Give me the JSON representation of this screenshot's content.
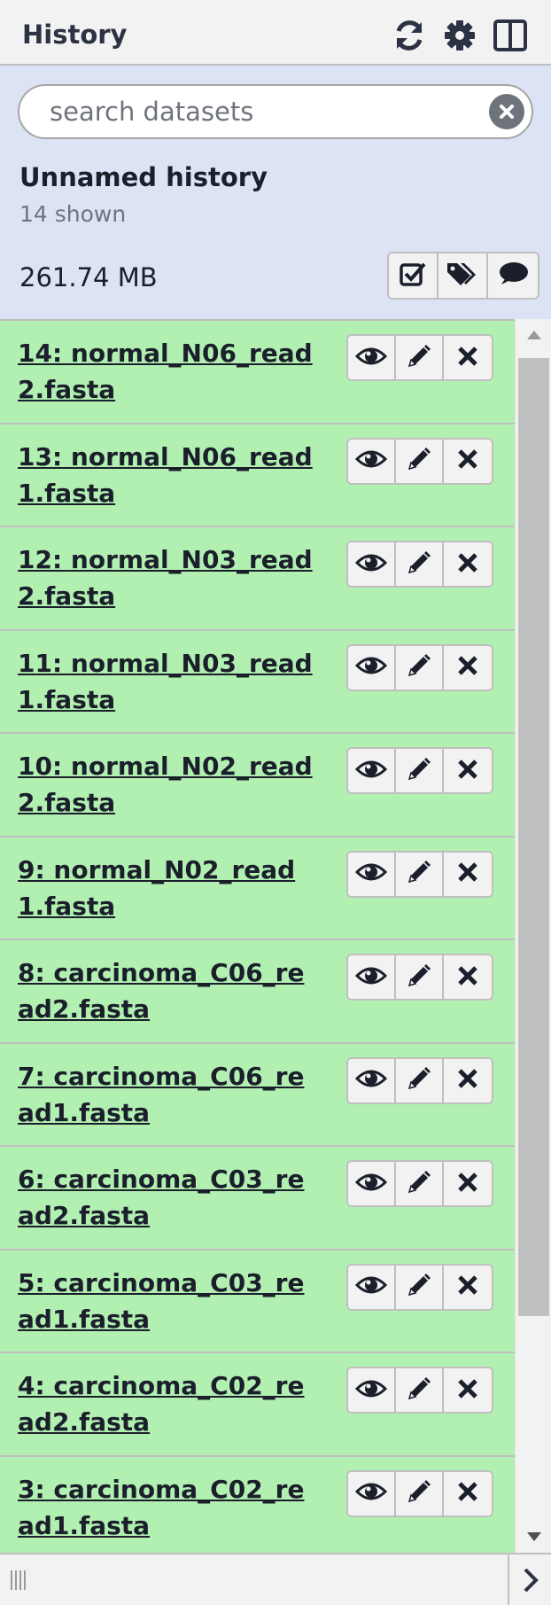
{
  "header": {
    "title": "History",
    "icons": [
      "refresh-icon",
      "gear-icon",
      "columns-icon"
    ]
  },
  "search": {
    "placeholder": "search datasets",
    "value": ""
  },
  "history": {
    "name": "Unnamed history",
    "shown": "14 shown",
    "size": "261.74 MB"
  },
  "history_actions": [
    "checkbox-icon",
    "tags-icon",
    "comment-icon"
  ],
  "datasets": [
    {
      "title": "14: normal_N06_read2.fasta"
    },
    {
      "title": "13: normal_N06_read1.fasta"
    },
    {
      "title": "12: normal_N03_read2.fasta"
    },
    {
      "title": "11: normal_N03_read1.fasta"
    },
    {
      "title": "10: normal_N02_read2.fasta"
    },
    {
      "title": "9: normal_N02_read1.fasta"
    },
    {
      "title": "8: carcinoma_C06_read2.fasta"
    },
    {
      "title": "7: carcinoma_C06_read1.fasta"
    },
    {
      "title": "6: carcinoma_C03_read2.fasta"
    },
    {
      "title": "5: carcinoma_C03_read1.fasta"
    },
    {
      "title": "4: carcinoma_C02_read2.fasta"
    },
    {
      "title": "3: carcinoma_C02_read1.fasta"
    }
  ],
  "dataset_actions": [
    "eye-icon",
    "pencil-icon",
    "delete-icon"
  ],
  "colors": {
    "dataset_ok": "#b2f0b2",
    "panel_bg": "#dce3f5",
    "header_bg": "#f2f2f2",
    "text": "#2c3143"
  },
  "footer": {
    "icons": [
      "drag-handle-icon",
      "chevron-right-icon"
    ]
  }
}
